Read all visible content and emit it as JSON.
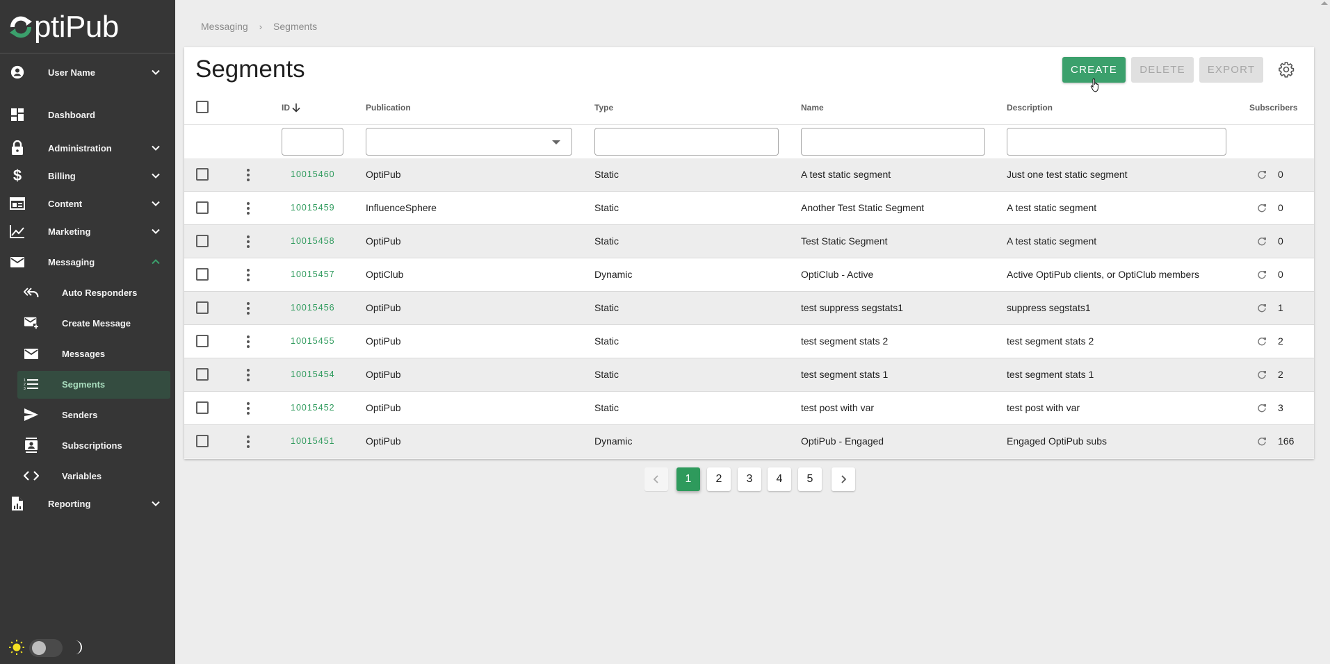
{
  "app": {
    "logo_text": "ptiPub",
    "brand_color": "#3ba06c"
  },
  "sidebar": {
    "user": {
      "label": "User Name",
      "icon": "account-circle-icon"
    },
    "items": [
      {
        "label": "Dashboard",
        "icon": "dashboard-icon",
        "expandable": false
      },
      {
        "label": "Administration",
        "icon": "lock-icon",
        "expandable": true,
        "expanded": false
      },
      {
        "label": "Billing",
        "icon": "dollar-icon",
        "expandable": true,
        "expanded": false
      },
      {
        "label": "Content",
        "icon": "content-layout-icon",
        "expandable": true,
        "expanded": false
      },
      {
        "label": "Marketing",
        "icon": "line-chart-icon",
        "expandable": true,
        "expanded": false
      },
      {
        "label": "Messaging",
        "icon": "mail-icon",
        "expandable": true,
        "expanded": true
      },
      {
        "label": "Reporting",
        "icon": "report-icon",
        "expandable": true,
        "expanded": false
      }
    ],
    "messaging_sub": [
      {
        "label": "Auto Responders",
        "icon": "reply-all-icon"
      },
      {
        "label": "Create Message",
        "icon": "mail-plus-icon"
      },
      {
        "label": "Messages",
        "icon": "mail-icon"
      },
      {
        "label": "Segments",
        "icon": "numbered-list-icon",
        "active": true
      },
      {
        "label": "Senders",
        "icon": "send-icon"
      },
      {
        "label": "Subscriptions",
        "icon": "contact-card-icon"
      },
      {
        "label": "Variables",
        "icon": "code-icon"
      }
    ],
    "theme": {
      "mode": "light"
    }
  },
  "breadcrumb": [
    "Messaging",
    "Segments"
  ],
  "page": {
    "title": "Segments",
    "buttons": {
      "create": "CREATE",
      "delete": "DELETE",
      "export": "EXPORT"
    }
  },
  "table": {
    "columns": {
      "id": "ID",
      "publication": "Publication",
      "type": "Type",
      "name": "Name",
      "description": "Description",
      "subscribers": "Subscribers"
    },
    "sort": {
      "column": "ID",
      "direction": "desc"
    },
    "filters": {
      "id": "",
      "publication": "",
      "type": "",
      "name": "",
      "description": ""
    },
    "rows": [
      {
        "id": "10015460",
        "publication": "OptiPub",
        "type": "Static",
        "name": "A test static segment",
        "description": "Just one test static segment",
        "subscribers": "0"
      },
      {
        "id": "10015459",
        "publication": "InfluenceSphere",
        "type": "Static",
        "name": "Another Test Static Segment",
        "description": "A test static segment",
        "subscribers": "0"
      },
      {
        "id": "10015458",
        "publication": "OptiPub",
        "type": "Static",
        "name": "Test Static Segment",
        "description": "A test static segment",
        "subscribers": "0"
      },
      {
        "id": "10015457",
        "publication": "OptiClub",
        "type": "Dynamic",
        "name": "OptiClub - Active",
        "description": "Active OptiPub clients, or OptiClub members",
        "subscribers": "0"
      },
      {
        "id": "10015456",
        "publication": "OptiPub",
        "type": "Static",
        "name": "test suppress segstats1",
        "description": "suppress segstats1",
        "subscribers": "1"
      },
      {
        "id": "10015455",
        "publication": "OptiPub",
        "type": "Static",
        "name": "test segment stats 2",
        "description": "test segment stats 2",
        "subscribers": "2"
      },
      {
        "id": "10015454",
        "publication": "OptiPub",
        "type": "Static",
        "name": "test segment stats 1",
        "description": "test segment stats 1",
        "subscribers": "2"
      },
      {
        "id": "10015452",
        "publication": "OptiPub",
        "type": "Static",
        "name": "test post with var",
        "description": "test post with var",
        "subscribers": "3"
      },
      {
        "id": "10015451",
        "publication": "OptiPub",
        "type": "Dynamic",
        "name": "OptiPub - Engaged",
        "description": "Engaged OptiPub subs",
        "subscribers": "166"
      }
    ]
  },
  "pagination": {
    "pages": [
      "1",
      "2",
      "3",
      "4",
      "5"
    ],
    "current": "1",
    "prev": "‹",
    "next": "›"
  }
}
